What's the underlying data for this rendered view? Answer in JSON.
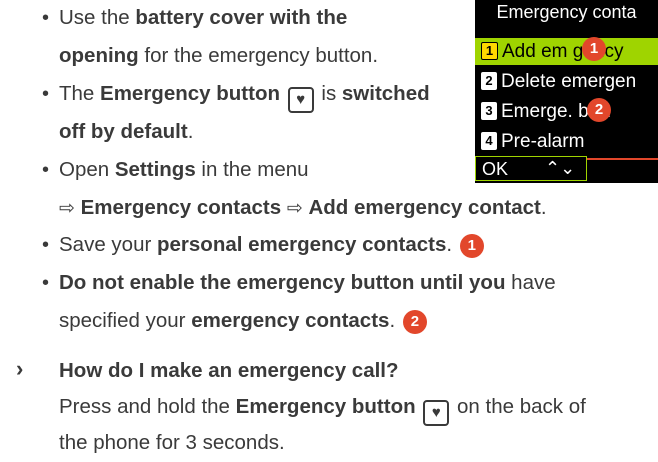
{
  "bullet_char": "•",
  "bullet1": {
    "t1": "Use the ",
    "b1": "battery cover with the",
    "b2": "opening",
    "t2": " for the emergency button."
  },
  "bullet2": {
    "t1": "The ",
    "b1": "Emergency button",
    "t2": " is ",
    "b2": "switched",
    "b3": "off by default",
    "t3": "."
  },
  "bullet3": {
    "t1": "Open ",
    "b1": "Settings",
    "t2": " in the menu",
    "arrow": "⇨",
    "b2": "Emergency contacts",
    "b3": "Add emergency contact",
    "t3": "."
  },
  "bullet4": {
    "t1": "Save your ",
    "b1": "personal emergency contacts",
    "t2": ". ",
    "marker": "1"
  },
  "bullet5": {
    "b1": "Do not enable the emergency button until you",
    "t1": " have",
    "t2": "specified your ",
    "b2": "emergency contacts",
    "t3": ". ",
    "marker": "2"
  },
  "faq": {
    "chevron": "›",
    "question": "How do I make an emergency call?",
    "t1": "Press and hold the ",
    "b1": "Emergency button",
    "t2": " on the back of",
    "t3": "the phone for 3 seconds."
  },
  "heart_symbol": "♥",
  "screen": {
    "title": "Emergency conta",
    "items": [
      {
        "n": "1",
        "label": "Add em  gency"
      },
      {
        "n": "2",
        "label": "Delete emergen"
      },
      {
        "n": "3",
        "label": "Emerge.   butt"
      },
      {
        "n": "4",
        "label": "Pre-alarm"
      }
    ],
    "ok": "OK",
    "scroll": "⌃⌄",
    "marker1": "1",
    "marker2": "2"
  },
  "colors": {
    "accent_red": "#e2472b",
    "highlight_green": "#9fd400",
    "text": "#3a3a3a"
  }
}
